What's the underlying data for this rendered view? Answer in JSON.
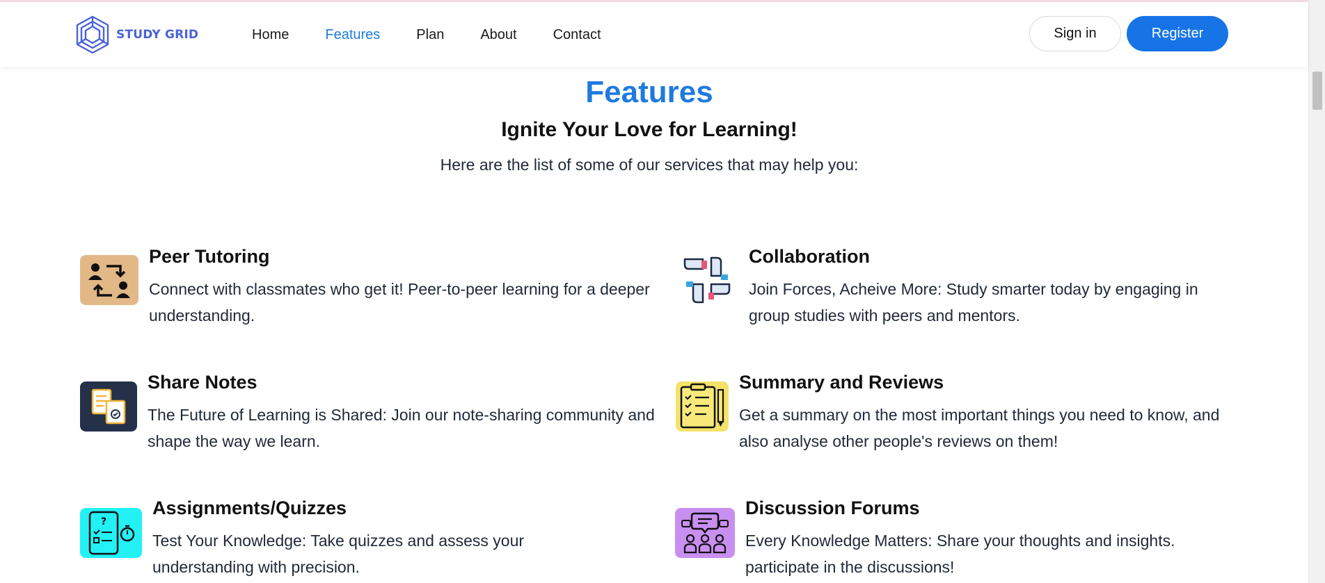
{
  "brand": {
    "name": "STUDY GRID",
    "logo_color": "#4a63d8"
  },
  "nav": {
    "items": [
      {
        "label": "Home",
        "active": false
      },
      {
        "label": "Features",
        "active": true
      },
      {
        "label": "Plan",
        "active": false
      },
      {
        "label": "About",
        "active": false
      },
      {
        "label": "Contact",
        "active": false
      }
    ]
  },
  "auth": {
    "signin_label": "Sign in",
    "register_label": "Register"
  },
  "section": {
    "title": "Features",
    "subtitle": "Ignite Your Love for Learning!",
    "lead": "Here are the list of some of our services that may help you:"
  },
  "features": [
    {
      "icon": "peer-tutoring-icon",
      "title": "Peer Tutoring",
      "description": "Connect with classmates who get it! Peer-to-peer learning for a deeper understanding."
    },
    {
      "icon": "collaboration-icon",
      "title": "Collaboration",
      "description": "Join Forces, Acheive More: Study smarter today by engaging in group studies with peers and mentors."
    },
    {
      "icon": "share-notes-icon",
      "title": "Share Notes",
      "description": "The Future of Learning is Shared: Join our note-sharing community and shape the way we learn."
    },
    {
      "icon": "summary-reviews-icon",
      "title": "Summary and Reviews",
      "description": "Get a summary on the most important things you need to know, and also analyse other people's reviews on them!"
    },
    {
      "icon": "assignments-quizzes-icon",
      "title": "Assignments/Quizzes",
      "description": "Test Your Knowledge: Take quizzes and assess your understanding with precision."
    },
    {
      "icon": "discussion-forums-icon",
      "title": "Discussion Forums",
      "description": "Every Knowledge Matters: Share your thoughts and insights. participate in the discussions!"
    }
  ],
  "colors": {
    "accent": "#1f7ae0",
    "register_bg": "#1674e6",
    "peer_tutoring_bg": "#e2b887",
    "share_notes_bg": "#243149",
    "summary_bg": "#f4e26a",
    "assignments_bg": "#22f1f5",
    "discussion_bg": "#c98ff0"
  }
}
